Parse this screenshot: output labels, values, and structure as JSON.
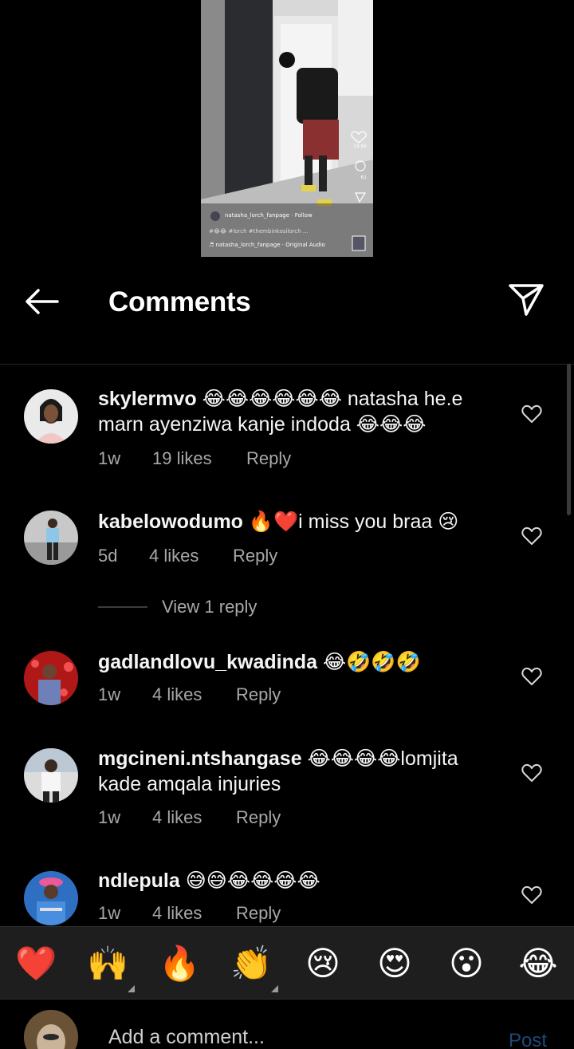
{
  "video": {
    "username_line": "natasha_lorch_fanpage · Follow",
    "hashtags": "#😂😂 #lorch #thembinkosilorch ...",
    "audio": "♬ natasha_lorch_fanpage · Original Audio",
    "likes_count": "19.6k",
    "comments_count": "61"
  },
  "header": {
    "title": "Comments"
  },
  "comments": [
    {
      "user": "skylermvo",
      "text": "😂😂😂😂😂😂 natasha he.e marn ayenziwa kanje indoda 😂😂😂",
      "time": "1w",
      "likes": "19 likes",
      "reply": "Reply"
    },
    {
      "user": "kabelowodumo",
      "text": "🔥❤️i miss you braa 😢",
      "time": "5d",
      "likes": "4 likes",
      "reply": "Reply",
      "view_replies": "View 1 reply"
    },
    {
      "user": "gadlandlovu_kwadinda",
      "text": "😂🤣🤣🤣",
      "time": "1w",
      "likes": "4 likes",
      "reply": "Reply"
    },
    {
      "user": "mgcineni.ntshangase",
      "text": "😂😂😂😂lomjita kade amqala injuries",
      "time": "1w",
      "likes": "4 likes",
      "reply": "Reply"
    },
    {
      "user": "ndlepula",
      "text": "😅😅😂😂😂😂",
      "time": "1w",
      "likes": "4 likes",
      "reply": "Reply"
    }
  ],
  "emoji_bar": [
    "❤️",
    "🙌",
    "🔥",
    "👏",
    "😢",
    "😍",
    "😮",
    "😂"
  ],
  "input": {
    "placeholder": "Add a comment...",
    "post_label": "Post",
    "post_color": "#1c4a78"
  },
  "colors": {
    "background": "#000000",
    "secondary_text": "#a8a8a8",
    "emoji_bar_bg": "#1e1e1e"
  }
}
